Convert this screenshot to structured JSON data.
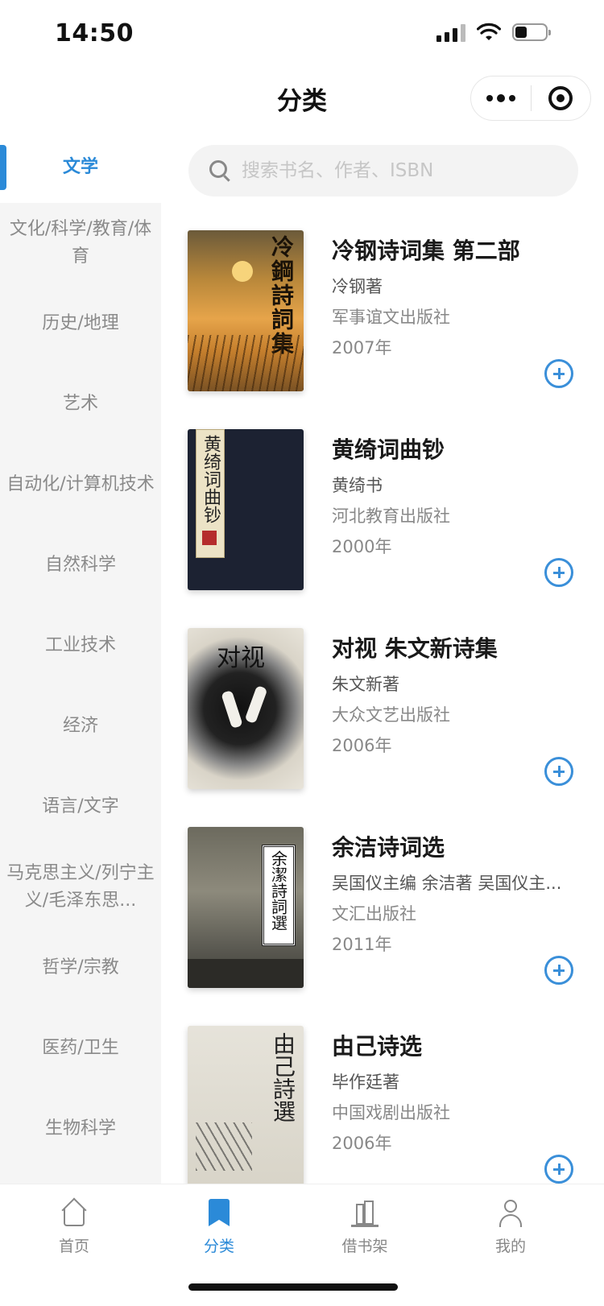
{
  "status_bar": {
    "time": "14:50",
    "icons": [
      "signal-icon",
      "wifi-icon",
      "battery-icon"
    ]
  },
  "nav": {
    "title": "分类",
    "capsule_icons": [
      "more-icon",
      "close-target-icon"
    ]
  },
  "search": {
    "placeholder": "搜索书名、作者、ISBN",
    "value": ""
  },
  "sidebar": {
    "items": [
      {
        "label": "文学",
        "active": true
      },
      {
        "label": "文化/科学/教育/体育",
        "active": false
      },
      {
        "label": "历史/地理",
        "active": false
      },
      {
        "label": "艺术",
        "active": false
      },
      {
        "label": "自动化/计算机技术",
        "active": false
      },
      {
        "label": "自然科学",
        "active": false
      },
      {
        "label": "工业技术",
        "active": false
      },
      {
        "label": "经济",
        "active": false
      },
      {
        "label": "语言/文字",
        "active": false
      },
      {
        "label": "马克思主义/列宁主义/毛泽东思...",
        "active": false
      },
      {
        "label": "哲学/宗教",
        "active": false
      },
      {
        "label": "医药/卫生",
        "active": false
      },
      {
        "label": "生物科学",
        "active": false
      }
    ]
  },
  "books": [
    {
      "title": "冷钢诗词集 第二部",
      "author": "冷钢著",
      "publisher": "军事谊文出版社",
      "year": "2007年",
      "cover_text": "冷鋼詩詞集"
    },
    {
      "title": "黄绮词曲钞",
      "author": "黄绮书",
      "publisher": "河北教育出版社",
      "year": "2000年",
      "cover_text": "黄绮词曲钞"
    },
    {
      "title": "对视 朱文新诗集",
      "author": "朱文新著",
      "publisher": "大众文艺出版社",
      "year": "2006年",
      "cover_text": "对视"
    },
    {
      "title": "余洁诗词选",
      "author": "吴国仪主编 余洁著 吴国仪主...",
      "publisher": "文汇出版社",
      "year": "2011年",
      "cover_text": "余潔詩詞選"
    },
    {
      "title": "由己诗选",
      "author": "毕作廷著",
      "publisher": "中国戏剧出版社",
      "year": "2006年",
      "cover_text": "由己詩選"
    }
  ],
  "tab_bar": {
    "items": [
      {
        "label": "首页",
        "icon": "home-icon",
        "active": false
      },
      {
        "label": "分类",
        "icon": "bookmark-icon",
        "active": true
      },
      {
        "label": "借书架",
        "icon": "bookshelf-icon",
        "active": false
      },
      {
        "label": "我的",
        "icon": "user-icon",
        "active": false
      }
    ]
  },
  "colors": {
    "accent": "#2b8ad8",
    "sidebar_bg": "#f5f5f5",
    "add_button": "#3a8fd9"
  }
}
